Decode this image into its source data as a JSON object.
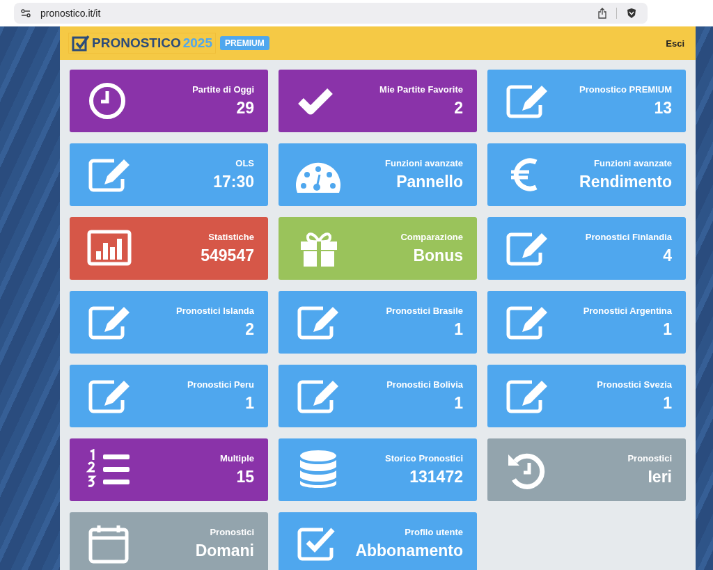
{
  "browser": {
    "url": "pronostico.it/it"
  },
  "header": {
    "logo_text": "PRONOSTICO",
    "logo_year": "2025",
    "badge": "PREMIUM",
    "logout": "Esci"
  },
  "tiles": [
    {
      "kind": "clock",
      "color": "#8a33a9",
      "label": "Partite di Oggi",
      "value": "29"
    },
    {
      "kind": "check",
      "color": "#8a33a9",
      "label": "Mie Partite Favorite",
      "value": "2"
    },
    {
      "kind": "edit",
      "color": "#4fa7ee",
      "label": "Pronostico PREMIUM",
      "value": "13"
    },
    {
      "kind": "edit",
      "color": "#4fa7ee",
      "label": "OLS",
      "value": "17:30"
    },
    {
      "kind": "gauge",
      "color": "#4fa7ee",
      "label": "Funzioni avanzate",
      "value": "Pannello"
    },
    {
      "kind": "euro",
      "color": "#4fa7ee",
      "label": "Funzioni avanzate",
      "value": "Rendimento"
    },
    {
      "kind": "chart",
      "color": "#d65748",
      "label": "Statistiche",
      "value": "549547"
    },
    {
      "kind": "gift",
      "color": "#9ac35b",
      "label": "Comparazione",
      "value": "Bonus"
    },
    {
      "kind": "edit",
      "color": "#4fa7ee",
      "label": "Pronostici Finlandia",
      "value": "4"
    },
    {
      "kind": "edit",
      "color": "#4fa7ee",
      "label": "Pronostici Islanda",
      "value": "2"
    },
    {
      "kind": "edit",
      "color": "#4fa7ee",
      "label": "Pronostici Brasile",
      "value": "1"
    },
    {
      "kind": "edit",
      "color": "#4fa7ee",
      "label": "Pronostici Argentina",
      "value": "1"
    },
    {
      "kind": "edit",
      "color": "#4fa7ee",
      "label": "Pronostici Peru",
      "value": "1"
    },
    {
      "kind": "edit",
      "color": "#4fa7ee",
      "label": "Pronostici Bolivia",
      "value": "1"
    },
    {
      "kind": "edit",
      "color": "#4fa7ee",
      "label": "Pronostici Svezia",
      "value": "1"
    },
    {
      "kind": "list",
      "color": "#8a33a9",
      "label": "Multiple",
      "value": "15"
    },
    {
      "kind": "database",
      "color": "#4fa7ee",
      "label": "Storico Pronostici",
      "value": "131472"
    },
    {
      "kind": "history",
      "color": "#93a4ad",
      "label": "Pronostici",
      "value": "Ieri"
    },
    {
      "kind": "calendar",
      "color": "#93a4ad",
      "label": "Pronostici",
      "value": "Domani"
    },
    {
      "kind": "checkbox",
      "color": "#4fa7ee",
      "label": "Profilo utente",
      "value": "Abbonamento"
    }
  ]
}
